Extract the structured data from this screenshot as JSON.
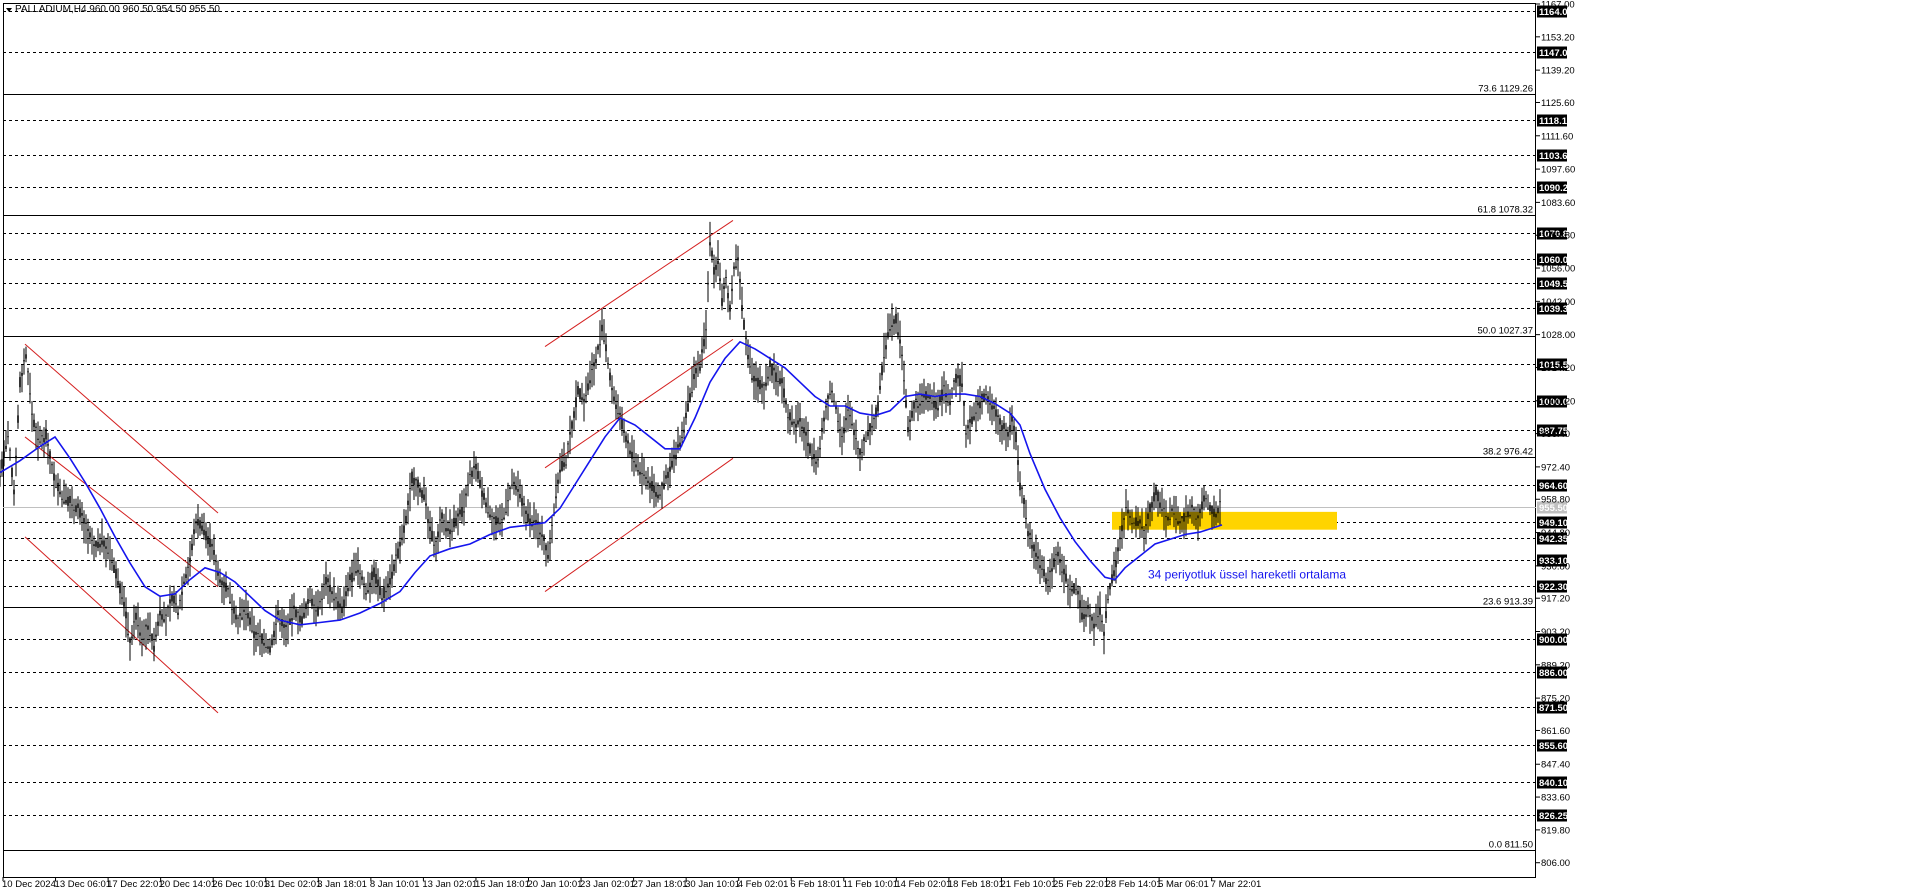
{
  "header": {
    "title": "PALLADIUM,H4  960.00 960.50 954.50 955.50"
  },
  "chart_data": {
    "type": "candlestick",
    "symbol": "PALLADIUM",
    "timeframe": "H4",
    "ohlc": {
      "open": 960.0,
      "high": 960.5,
      "low": 954.5,
      "close": 955.5
    },
    "y_axis": {
      "range": [
        800.5,
        1167.0
      ],
      "tick_labels": [
        "806.00",
        "819.80",
        "833.60",
        "847.40",
        "861.60",
        "875.20",
        "889.20",
        "903.20",
        "917.20",
        "930.80",
        "944.80",
        "958.80",
        "972.40",
        "986.40",
        "1000.20",
        "1014.20",
        "1028.00",
        "1042.00",
        "1056.00",
        "1069.80",
        "1083.60",
        "1097.60",
        "1111.60",
        "1125.60",
        "1139.20",
        "1153.20",
        "1167.00"
      ]
    },
    "x_axis": {
      "labels": [
        "10 Dec 2024",
        "13 Dec 06:01",
        "17 Dec 22:01",
        "20 Dec 14:01",
        "26 Dec 10:01",
        "31 Dec 02:01",
        "3 Jan 18:01",
        "8 Jan 10:01",
        "13 Jan 02:01",
        "15 Jan 18:01",
        "20 Jan 10:01",
        "23 Jan 02:01",
        "27 Jan 18:01",
        "30 Jan 10:01",
        "4 Feb 02:01",
        "6 Feb 18:01",
        "11 Feb 10:01",
        "14 Feb 02:01",
        "18 Feb 18:01",
        "21 Feb 10:01",
        "25 Feb 22:01",
        "28 Feb 14:01",
        "5 Mar 06:01",
        "7 Mar 22:01"
      ]
    },
    "price_levels": [
      "1164.00",
      "1147.00",
      "1118.10",
      "1103.60",
      "1090.20",
      "1070.85",
      "1060.00",
      "1049.50",
      "1039.30",
      "1015.55",
      "1000.00",
      "987.75",
      "964.60",
      "955.50",
      "949.10",
      "942.35",
      "933.10",
      "922.30",
      "900.00",
      "886.00",
      "871.50",
      "855.60",
      "840.10",
      "826.25"
    ],
    "current_price": "955.50",
    "fibonacci": [
      {
        "label": "73.6 1129.26",
        "value": 1129.26
      },
      {
        "label": "61.8 1078.32",
        "value": 1078.32
      },
      {
        "label": "50.0 1027.37",
        "value": 1027.37
      },
      {
        "label": "38.2 976.42",
        "value": 976.42
      },
      {
        "label": "23.6 913.39",
        "value": 913.39
      },
      {
        "label": "0.0 811.50",
        "value": 811.5
      }
    ],
    "support_zone": [
      946.0,
      953.5
    ],
    "ema_period": 34,
    "annotation": "34 periyotluk üssel hareketli ortalama",
    "series_path": [
      [
        0,
        970
      ],
      [
        8,
        985
      ],
      [
        14,
        962
      ],
      [
        20,
        1008
      ],
      [
        26,
        1020
      ],
      [
        32,
        995
      ],
      [
        38,
        983
      ],
      [
        46,
        986
      ],
      [
        54,
        968
      ],
      [
        62,
        960
      ],
      [
        70,
        958
      ],
      [
        78,
        955
      ],
      [
        86,
        947
      ],
      [
        94,
        938
      ],
      [
        102,
        942
      ],
      [
        110,
        935
      ],
      [
        118,
        925
      ],
      [
        124,
        915
      ],
      [
        130,
        898
      ],
      [
        136,
        910
      ],
      [
        142,
        900
      ],
      [
        148,
        906
      ],
      [
        154,
        897
      ],
      [
        160,
        912
      ],
      [
        166,
        908
      ],
      [
        172,
        918
      ],
      [
        178,
        912
      ],
      [
        184,
        925
      ],
      [
        190,
        933
      ],
      [
        196,
        950
      ],
      [
        202,
        948
      ],
      [
        208,
        942
      ],
      [
        214,
        936
      ],
      [
        220,
        925
      ],
      [
        226,
        922
      ],
      [
        232,
        915
      ],
      [
        238,
        908
      ],
      [
        246,
        912
      ],
      [
        254,
        902
      ],
      [
        262,
        900
      ],
      [
        270,
        896
      ],
      [
        278,
        910
      ],
      [
        286,
        904
      ],
      [
        294,
        912
      ],
      [
        302,
        908
      ],
      [
        310,
        918
      ],
      [
        318,
        912
      ],
      [
        326,
        925
      ],
      [
        334,
        918
      ],
      [
        342,
        912
      ],
      [
        350,
        925
      ],
      [
        358,
        930
      ],
      [
        366,
        920
      ],
      [
        374,
        928
      ],
      [
        382,
        918
      ],
      [
        390,
        925
      ],
      [
        398,
        936
      ],
      [
        406,
        950
      ],
      [
        412,
        968
      ],
      [
        418,
        965
      ],
      [
        424,
        960
      ],
      [
        430,
        945
      ],
      [
        436,
        940
      ],
      [
        442,
        952
      ],
      [
        448,
        945
      ],
      [
        456,
        950
      ],
      [
        464,
        955
      ],
      [
        470,
        968
      ],
      [
        476,
        972
      ],
      [
        482,
        962
      ],
      [
        488,
        955
      ],
      [
        494,
        950
      ],
      [
        500,
        948
      ],
      [
        506,
        955
      ],
      [
        512,
        965
      ],
      [
        518,
        962
      ],
      [
        524,
        955
      ],
      [
        530,
        950
      ],
      [
        536,
        948
      ],
      [
        542,
        945
      ],
      [
        548,
        935
      ],
      [
        554,
        955
      ],
      [
        560,
        972
      ],
      [
        566,
        975
      ],
      [
        572,
        990
      ],
      [
        578,
        1005
      ],
      [
        584,
        1000
      ],
      [
        590,
        1010
      ],
      [
        596,
        1018
      ],
      [
        602,
        1030
      ],
      [
        606,
        1022
      ],
      [
        610,
        1010
      ],
      [
        616,
        998
      ],
      [
        622,
        990
      ],
      [
        628,
        982
      ],
      [
        634,
        975
      ],
      [
        640,
        970
      ],
      [
        646,
        968
      ],
      [
        652,
        964
      ],
      [
        658,
        960
      ],
      [
        664,
        965
      ],
      [
        670,
        972
      ],
      [
        676,
        978
      ],
      [
        682,
        985
      ],
      [
        688,
        998
      ],
      [
        694,
        1010
      ],
      [
        700,
        1015
      ],
      [
        706,
        1030
      ],
      [
        710,
        1068
      ],
      [
        714,
        1055
      ],
      [
        718,
        1060
      ],
      [
        722,
        1042
      ],
      [
        726,
        1050
      ],
      [
        730,
        1040
      ],
      [
        734,
        1055
      ],
      [
        738,
        1060
      ],
      [
        742,
        1040
      ],
      [
        746,
        1025
      ],
      [
        752,
        1010
      ],
      [
        758,
        1008
      ],
      [
        764,
        1005
      ],
      [
        770,
        1015
      ],
      [
        776,
        1010
      ],
      [
        782,
        1008
      ],
      [
        788,
        995
      ],
      [
        794,
        990
      ],
      [
        800,
        992
      ],
      [
        806,
        985
      ],
      [
        812,
        978
      ],
      [
        818,
        975
      ],
      [
        824,
        992
      ],
      [
        830,
        1005
      ],
      [
        836,
        998
      ],
      [
        842,
        985
      ],
      [
        848,
        995
      ],
      [
        854,
        988
      ],
      [
        860,
        978
      ],
      [
        866,
        985
      ],
      [
        872,
        990
      ],
      [
        878,
        998
      ],
      [
        884,
        1020
      ],
      [
        890,
        1032
      ],
      [
        896,
        1035
      ],
      [
        900,
        1025
      ],
      [
        904,
        1010
      ],
      [
        908,
        988
      ],
      [
        914,
        998
      ],
      [
        920,
        1000
      ],
      [
        926,
        1002
      ],
      [
        932,
        1000
      ],
      [
        938,
        998
      ],
      [
        944,
        1005
      ],
      [
        950,
        1000
      ],
      [
        956,
        1010
      ],
      [
        962,
        1008
      ],
      [
        966,
        988
      ],
      [
        972,
        992
      ],
      [
        978,
        998
      ],
      [
        984,
        1002
      ],
      [
        990,
        1000
      ],
      [
        996,
        995
      ],
      [
        1002,
        990
      ],
      [
        1008,
        985
      ],
      [
        1012,
        992
      ],
      [
        1016,
        985
      ],
      [
        1020,
        965
      ],
      [
        1024,
        958
      ],
      [
        1028,
        945
      ],
      [
        1034,
        938
      ],
      [
        1040,
        932
      ],
      [
        1046,
        925
      ],
      [
        1052,
        930
      ],
      [
        1058,
        935
      ],
      [
        1064,
        928
      ],
      [
        1070,
        920
      ],
      [
        1076,
        922
      ],
      [
        1082,
        910
      ],
      [
        1088,
        912
      ],
      [
        1094,
        905
      ],
      [
        1100,
        912
      ],
      [
        1104,
        902
      ],
      [
        1108,
        918
      ],
      [
        1112,
        925
      ],
      [
        1116,
        932
      ],
      [
        1120,
        942
      ],
      [
        1126,
        955
      ],
      [
        1132,
        948
      ],
      [
        1138,
        950
      ],
      [
        1144,
        945
      ],
      [
        1150,
        955
      ],
      [
        1156,
        962
      ],
      [
        1162,
        955
      ],
      [
        1168,
        950
      ],
      [
        1174,
        955
      ],
      [
        1180,
        948
      ],
      [
        1186,
        952
      ],
      [
        1192,
        955
      ],
      [
        1198,
        950
      ],
      [
        1204,
        960
      ],
      [
        1210,
        955
      ],
      [
        1216,
        952
      ],
      [
        1222,
        958
      ]
    ],
    "ema_path": [
      [
        0,
        970
      ],
      [
        20,
        975
      ],
      [
        40,
        981
      ],
      [
        55,
        985
      ],
      [
        70,
        976
      ],
      [
        85,
        966
      ],
      [
        100,
        955
      ],
      [
        115,
        943
      ],
      [
        130,
        932
      ],
      [
        145,
        922
      ],
      [
        160,
        918
      ],
      [
        175,
        919
      ],
      [
        190,
        925
      ],
      [
        205,
        930
      ],
      [
        220,
        928
      ],
      [
        235,
        924
      ],
      [
        250,
        918
      ],
      [
        265,
        912
      ],
      [
        280,
        908
      ],
      [
        300,
        906
      ],
      [
        320,
        907
      ],
      [
        340,
        908
      ],
      [
        360,
        911
      ],
      [
        380,
        915
      ],
      [
        400,
        920
      ],
      [
        415,
        928
      ],
      [
        430,
        935
      ],
      [
        450,
        938
      ],
      [
        470,
        940
      ],
      [
        490,
        944
      ],
      [
        510,
        947
      ],
      [
        530,
        948
      ],
      [
        545,
        949
      ],
      [
        560,
        955
      ],
      [
        575,
        965
      ],
      [
        590,
        975
      ],
      [
        605,
        985
      ],
      [
        620,
        993
      ],
      [
        635,
        990
      ],
      [
        650,
        985
      ],
      [
        665,
        980
      ],
      [
        680,
        980
      ],
      [
        695,
        993
      ],
      [
        710,
        1008
      ],
      [
        725,
        1018
      ],
      [
        740,
        1025
      ],
      [
        755,
        1022
      ],
      [
        770,
        1018
      ],
      [
        785,
        1014
      ],
      [
        800,
        1008
      ],
      [
        815,
        1002
      ],
      [
        830,
        998
      ],
      [
        845,
        998
      ],
      [
        860,
        995
      ],
      [
        875,
        994
      ],
      [
        890,
        996
      ],
      [
        905,
        1002
      ],
      [
        920,
        1003
      ],
      [
        935,
        1002
      ],
      [
        950,
        1003
      ],
      [
        965,
        1003
      ],
      [
        980,
        1002
      ],
      [
        995,
        999
      ],
      [
        1010,
        995
      ],
      [
        1020,
        990
      ],
      [
        1030,
        978
      ],
      [
        1045,
        963
      ],
      [
        1060,
        951
      ],
      [
        1075,
        941
      ],
      [
        1090,
        933
      ],
      [
        1105,
        926
      ],
      [
        1115,
        925
      ],
      [
        1125,
        930
      ],
      [
        1140,
        935
      ],
      [
        1155,
        940
      ],
      [
        1170,
        942
      ],
      [
        1185,
        944
      ],
      [
        1200,
        945
      ],
      [
        1215,
        947
      ],
      [
        1222,
        948
      ]
    ]
  },
  "colors": {
    "background": "#ffffff",
    "candle": "#000000",
    "ema": "#1515ee",
    "channel": "#d42020",
    "zone": "#ffd400",
    "level_line": "#000000",
    "current_price_line": "#c0c0c0",
    "tag_background": "#000000",
    "tag_text": "#ffffff"
  }
}
